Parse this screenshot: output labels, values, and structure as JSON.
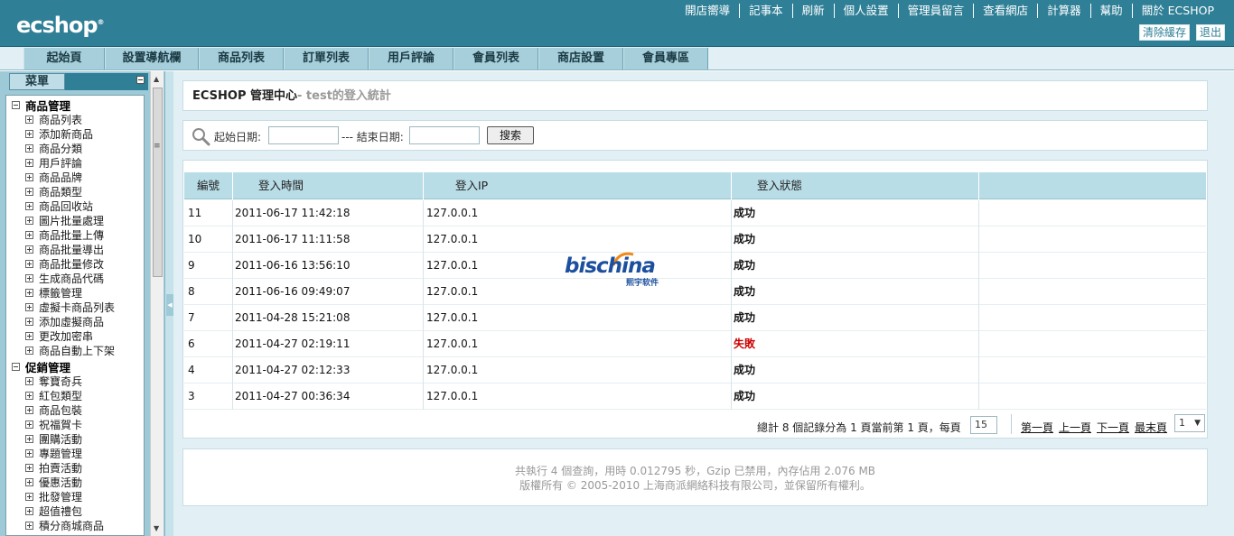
{
  "app": {
    "logo": "ecshop",
    "logo_mark": "®"
  },
  "top_links": [
    "開店嚮導",
    "記事本",
    "刷新",
    "個人設置",
    "管理員留言",
    "查看網店",
    "計算器",
    "幫助",
    "關於 ECSHOP"
  ],
  "top_buttons": {
    "clear_cache": "清除緩存",
    "logout": "退出"
  },
  "nav_tabs": [
    "起始頁",
    "設置導航欄",
    "商品列表",
    "訂單列表",
    "用戶評論",
    "會員列表",
    "商店設置",
    "會員專區"
  ],
  "sidebar": {
    "tab_label": "菜單",
    "groups": [
      {
        "label": "商品管理",
        "items": [
          "商品列表",
          "添加新商品",
          "商品分類",
          "用戶評論",
          "商品品牌",
          "商品類型",
          "商品回收站",
          "圖片批量處理",
          "商品批量上傳",
          "商品批量導出",
          "商品批量修改",
          "生成商品代碼",
          "標籤管理",
          "虛擬卡商品列表",
          "添加虛擬商品",
          "更改加密串",
          "商品自動上下架"
        ]
      },
      {
        "label": "促銷管理",
        "items": [
          "奪寶奇兵",
          "紅包類型",
          "商品包裝",
          "祝福賀卡",
          "團購活動",
          "專題管理",
          "拍賣活動",
          "優惠活動",
          "批發管理",
          "超值禮包",
          "積分商城商品"
        ]
      }
    ]
  },
  "header": {
    "title": "ECSHOP 管理中心",
    "subtitle": "- test的登入統計"
  },
  "search": {
    "start_label": "起始日期:",
    "end_label": "--- 結束日期:",
    "start_value": "",
    "end_value": "",
    "button": "搜索"
  },
  "table": {
    "columns": [
      "編號",
      "登入時間",
      "登入IP",
      "登入狀態"
    ],
    "rows": [
      {
        "id": "11",
        "time": "2011-06-17 11:42:18",
        "ip": "127.0.0.1",
        "status": "成功",
        "ok": true
      },
      {
        "id": "10",
        "time": "2011-06-17 11:11:58",
        "ip": "127.0.0.1",
        "status": "成功",
        "ok": true
      },
      {
        "id": "9",
        "time": "2011-06-16 13:56:10",
        "ip": "127.0.0.1",
        "status": "成功",
        "ok": true
      },
      {
        "id": "8",
        "time": "2011-06-16 09:49:07",
        "ip": "127.0.0.1",
        "status": "成功",
        "ok": true
      },
      {
        "id": "7",
        "time": "2011-04-28 15:21:08",
        "ip": "127.0.0.1",
        "status": "成功",
        "ok": true
      },
      {
        "id": "6",
        "time": "2011-04-27 02:19:11",
        "ip": "127.0.0.1",
        "status": "失敗",
        "ok": false
      },
      {
        "id": "4",
        "time": "2011-04-27 02:12:33",
        "ip": "127.0.0.1",
        "status": "成功",
        "ok": true
      },
      {
        "id": "3",
        "time": "2011-04-27 00:36:34",
        "ip": "127.0.0.1",
        "status": "成功",
        "ok": true
      }
    ]
  },
  "pager": {
    "summary": "總計 8 個記錄分為 1 頁當前第 1 頁，每頁",
    "per_page": "15",
    "first": "第一頁",
    "prev": "上一頁",
    "next": "下一頁",
    "last": "最末頁",
    "page": "1"
  },
  "footer": {
    "line1": "共執行 4 個查詢，用時 0.012795 秒，Gzip 已禁用，內存佔用 2.076 MB",
    "line2": "版權所有 © 2005-2010 上海商派網絡科技有限公司，並保留所有權利。"
  },
  "watermark": {
    "text_a": "bis",
    "text_b": "china",
    "sub": "熙宇软件"
  },
  "colors": {
    "brand": "#2f7f96",
    "nav": "#a6cfdb",
    "fail": "#cc0000",
    "panel_bg": "#e2f0f5"
  }
}
